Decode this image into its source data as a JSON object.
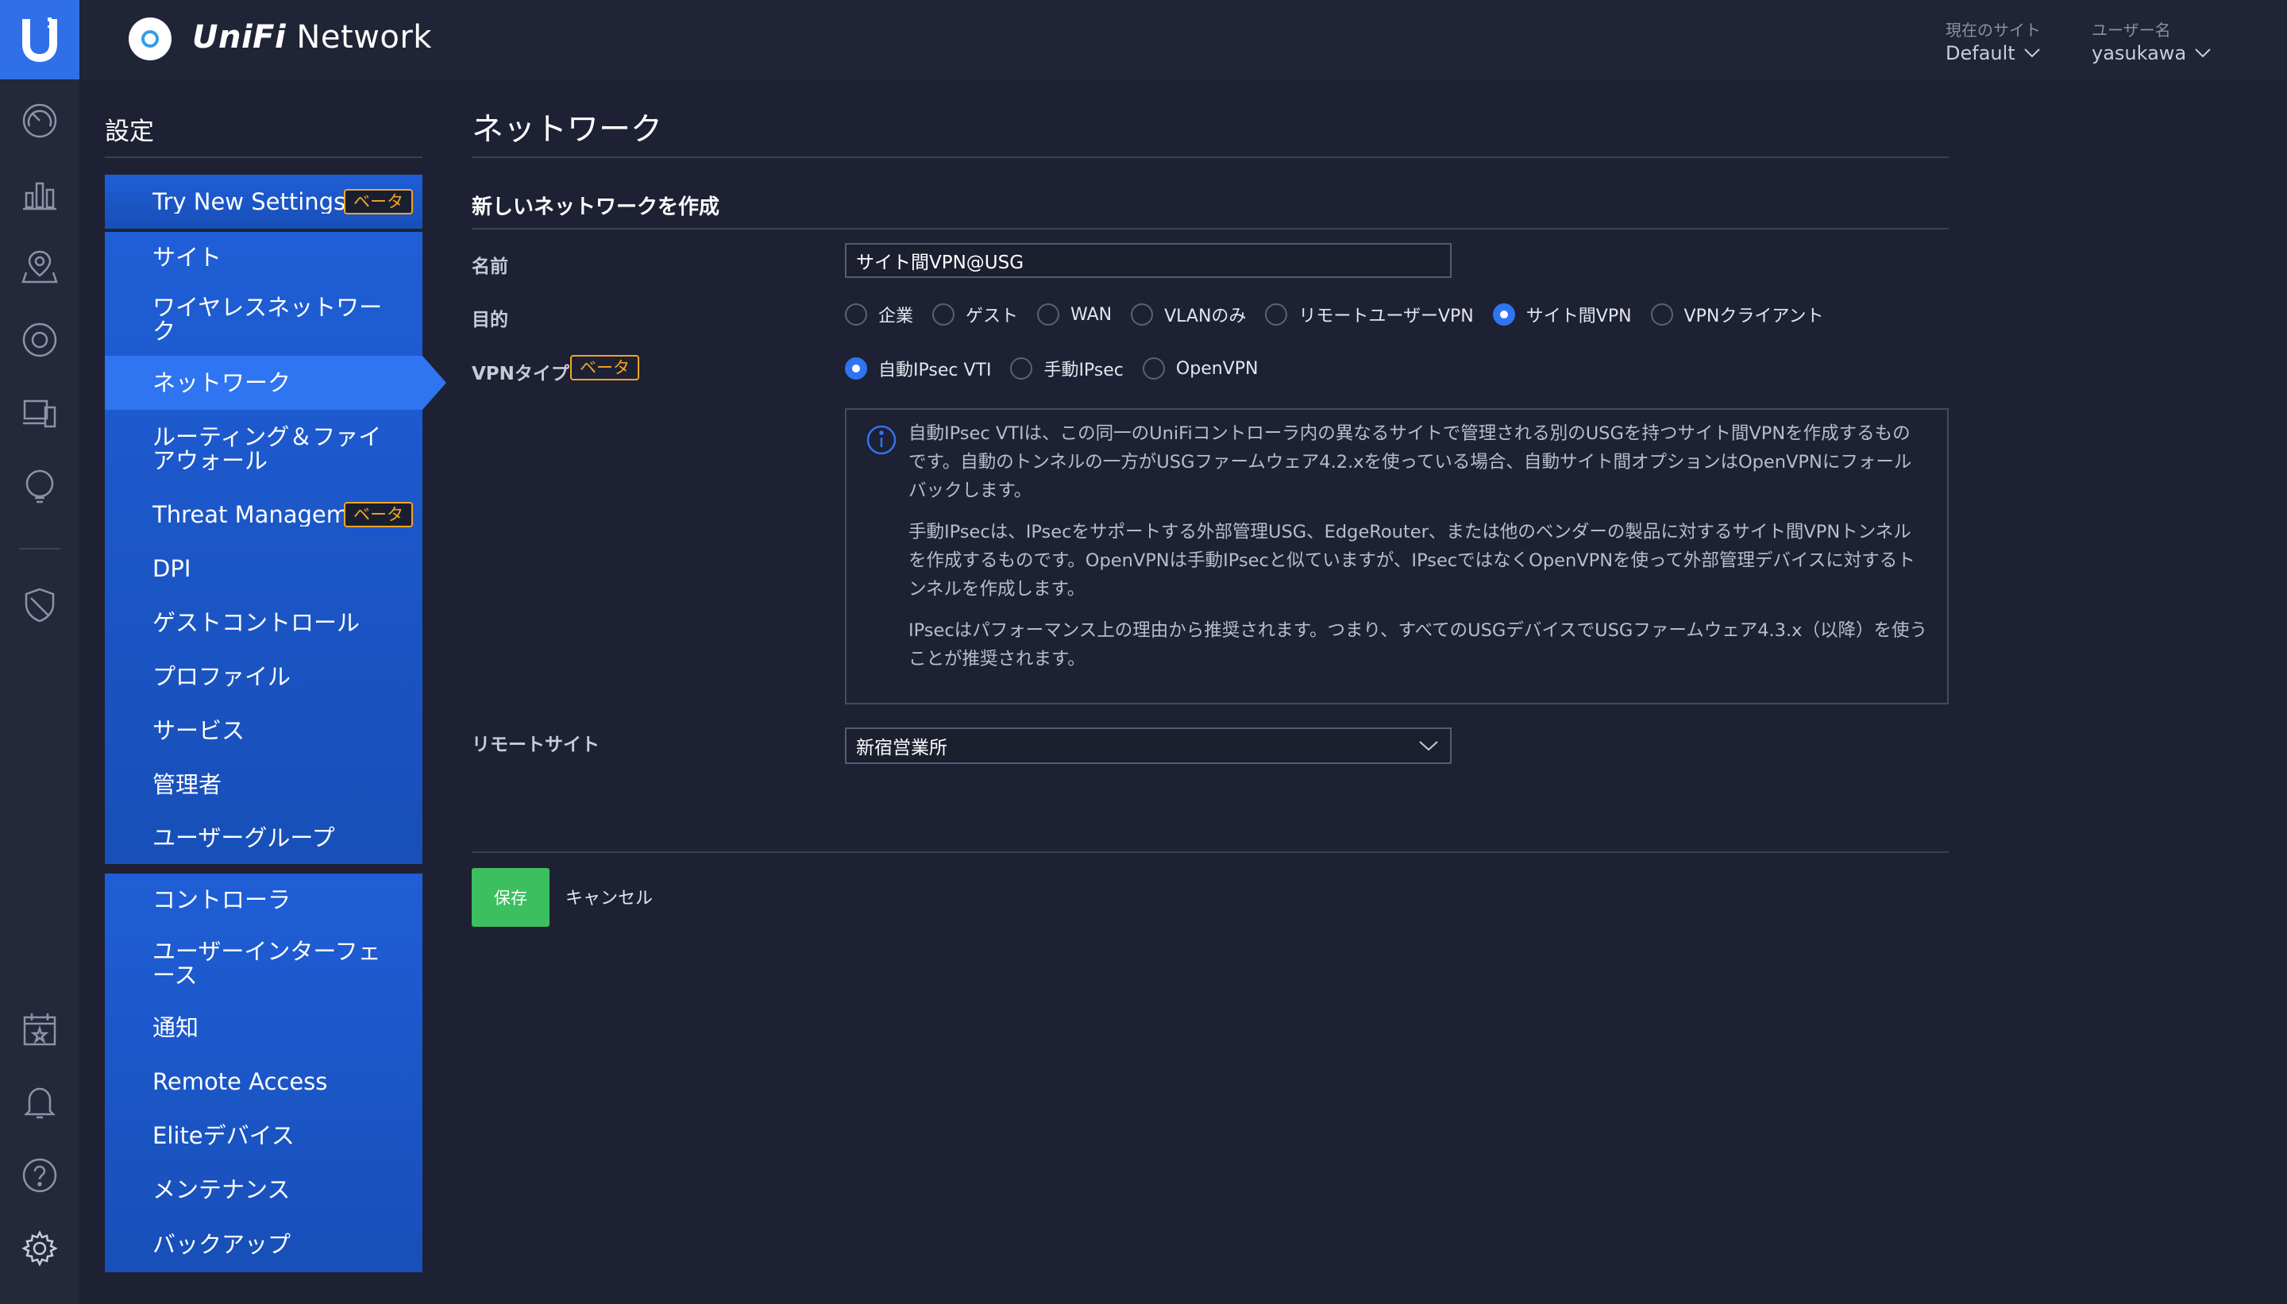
{
  "app": {
    "brand_unifi": "UniFi",
    "brand_network": "Network"
  },
  "topbar": {
    "site_label": "現在のサイト",
    "site_value": "Default",
    "user_label": "ユーザー名",
    "user_value": "yasukawa"
  },
  "rail": {
    "icons": [
      "dashboard-icon",
      "statistics-icon",
      "map-icon",
      "devices-icon",
      "clients-icon",
      "insights-icon",
      "threat-shield-icon",
      "events-calendar-icon",
      "alerts-bell-icon",
      "help-icon",
      "settings-gear-icon"
    ]
  },
  "settings": {
    "title": "設定",
    "beta_label": "ベータ",
    "groups": [
      [
        {
          "label": "Try New Settings",
          "beta": true
        }
      ],
      [
        {
          "label": "サイト"
        },
        {
          "label": "ワイヤレスネットワーク"
        },
        {
          "label": "ネットワーク",
          "active": true
        },
        {
          "label": "ルーティング＆ファイアウォール"
        },
        {
          "label": "Threat Management",
          "beta": true
        },
        {
          "label": "DPI"
        },
        {
          "label": "ゲストコントロール"
        },
        {
          "label": "プロファイル"
        },
        {
          "label": "サービス"
        },
        {
          "label": "管理者"
        },
        {
          "label": "ユーザーグループ"
        }
      ],
      [
        {
          "label": "コントローラ"
        },
        {
          "label": "ユーザーインターフェース"
        },
        {
          "label": "通知"
        },
        {
          "label": "Remote Access"
        },
        {
          "label": "Eliteデバイス"
        },
        {
          "label": "メンテナンス"
        },
        {
          "label": "バックアップ"
        }
      ]
    ]
  },
  "main": {
    "title": "ネットワーク",
    "section_title": "新しいネットワークを作成",
    "name_label": "名前",
    "name_value": "サイト間VPN@USG",
    "purpose_label": "目的",
    "purpose_options": [
      "企業",
      "ゲスト",
      "WAN",
      "VLANのみ",
      "リモートユーザーVPN",
      "サイト間VPN",
      "VPNクライアント"
    ],
    "purpose_selected": "サイト間VPN",
    "vpn_type_label": "VPNタイプ",
    "vpn_type_beta": "ベータ",
    "vpn_type_options": [
      "自動IPsec VTI",
      "手動IPsec",
      "OpenVPN"
    ],
    "vpn_type_selected": "自動IPsec VTI",
    "info": [
      "自動IPsec VTIは、この同一のUniFiコントローラ内の異なるサイトで管理される別のUSGを持つサイト間VPNを作成するものです。自動のトンネルの一方がUSGファームウェア4.2.xを使っている場合、自動サイト間オプションはOpenVPNにフォールバックします。",
      "手動IPsecは、IPsecをサポートする外部管理USG、EdgeRouter、または他のベンダーの製品に対するサイト間VPNトンネルを作成するものです。OpenVPNは手動IPsecと似ていますが、IPsecではなくOpenVPNを使って外部管理デバイスに対するトンネルを作成します。",
      "IPsecはパフォーマンス上の理由から推奨されます。つまり、すべてのUSGデバイスでUSGファームウェア4.3.x（以降）を使うことが推奨されます。"
    ],
    "remote_site_label": "リモートサイト",
    "remote_site_value": "新宿営業所",
    "save_label": "保存",
    "cancel_label": "キャンセル"
  },
  "colors": {
    "accent": "#2f74f0",
    "nav_bg": "#1f5ed6",
    "beta": "#f5a524",
    "save": "#3bbf5f",
    "page_bg": "#1d2133"
  }
}
